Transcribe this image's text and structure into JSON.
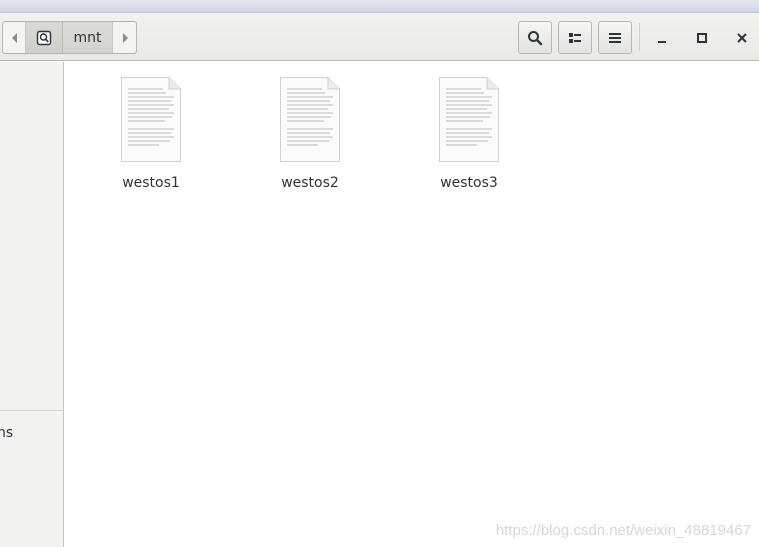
{
  "window": {
    "path": {
      "current": "mnt"
    },
    "toolbar": {
      "search_icon": "search-icon",
      "view_icon": "list-view-icon",
      "menu_icon": "hamburger-menu-icon"
    },
    "controls": {
      "minimize": "minimize-icon",
      "maximize": "maximize-icon",
      "close": "close-icon"
    }
  },
  "sidebar": {
    "truncated_item": "ns"
  },
  "files": [
    {
      "name": "westos1",
      "icon": "text-file-icon"
    },
    {
      "name": "westos2",
      "icon": "text-file-icon"
    },
    {
      "name": "westos3",
      "icon": "text-file-icon"
    }
  ],
  "watermark": "https://blog.csdn.net/weixin_48819467"
}
